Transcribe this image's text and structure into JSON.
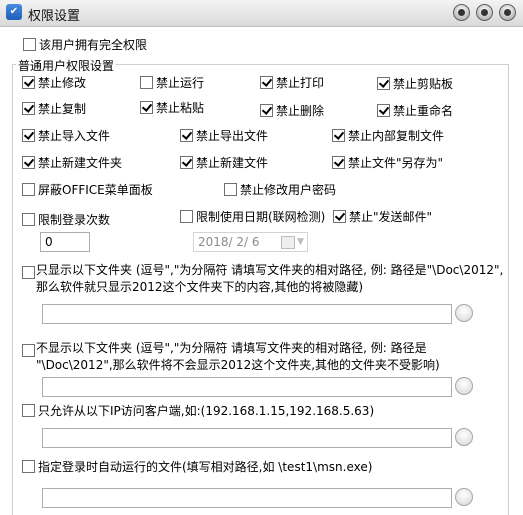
{
  "window": {
    "title": "权限设置"
  },
  "full_control": {
    "label": "该用户拥有完全权限",
    "checked": false
  },
  "group": {
    "label": "普通用户权限设置"
  },
  "perms": [
    {
      "label": "禁止修改",
      "checked": true
    },
    {
      "label": "禁止运行",
      "checked": false
    },
    {
      "label": "禁止打印",
      "checked": true
    },
    {
      "label": "禁止剪贴板",
      "checked": true
    },
    {
      "label": "禁止复制",
      "checked": true
    },
    {
      "label": "禁止粘贴",
      "checked": true
    },
    {
      "label": "禁止删除",
      "checked": true
    },
    {
      "label": "禁止重命名",
      "checked": true
    },
    {
      "label": "禁止导入文件",
      "checked": true
    },
    {
      "label": "禁止导出文件",
      "checked": true
    },
    {
      "label": "禁止内部复制文件",
      "checked": true
    },
    {
      "label": "禁止新建文件夹",
      "checked": true
    },
    {
      "label": "禁止新建文件",
      "checked": true
    },
    {
      "label": "禁止文件\"另存为\"",
      "checked": true
    },
    {
      "label": "屏蔽OFFICE菜单面板",
      "checked": false
    },
    {
      "label": "禁止修改用户密码",
      "checked": false
    }
  ],
  "limit_login": {
    "label": "限制登录次数",
    "checked": false,
    "value": "0"
  },
  "limit_date": {
    "label": "限制使用日期(联网检测)",
    "checked": false,
    "value": "2018/  2/  6"
  },
  "no_email": {
    "label": "禁止\"发送邮件\"",
    "checked": true
  },
  "only_show": {
    "line1": "只显示以下文件夹 (逗号\",\"为分隔符 请填写文件夹的相对路径, 例: 路径是\"\\Doc\\2012\",",
    "line2": "那么软件就只显示2012这个文件夹下的内容,其他的将被隐藏)",
    "checked": false,
    "value": ""
  },
  "hide_show": {
    "line1": "不显示以下文件夹 (逗号\",\"为分隔符 请填写文件夹的相对路径, 例: 路径是",
    "line2": "\"\\Doc\\2012\",那么软件将不会显示2012这个文件夹,其他的文件夹不受影响)",
    "checked": false,
    "value": ""
  },
  "ip_allow": {
    "label": "只允许从以下IP访问客户端,如:(192.168.1.15,192.168.5.63)",
    "checked": false,
    "value": ""
  },
  "autorun": {
    "label": "指定登录时自动运行的文件(填写相对路径,如 \\test1\\msn.exe)",
    "checked": false,
    "value": ""
  }
}
